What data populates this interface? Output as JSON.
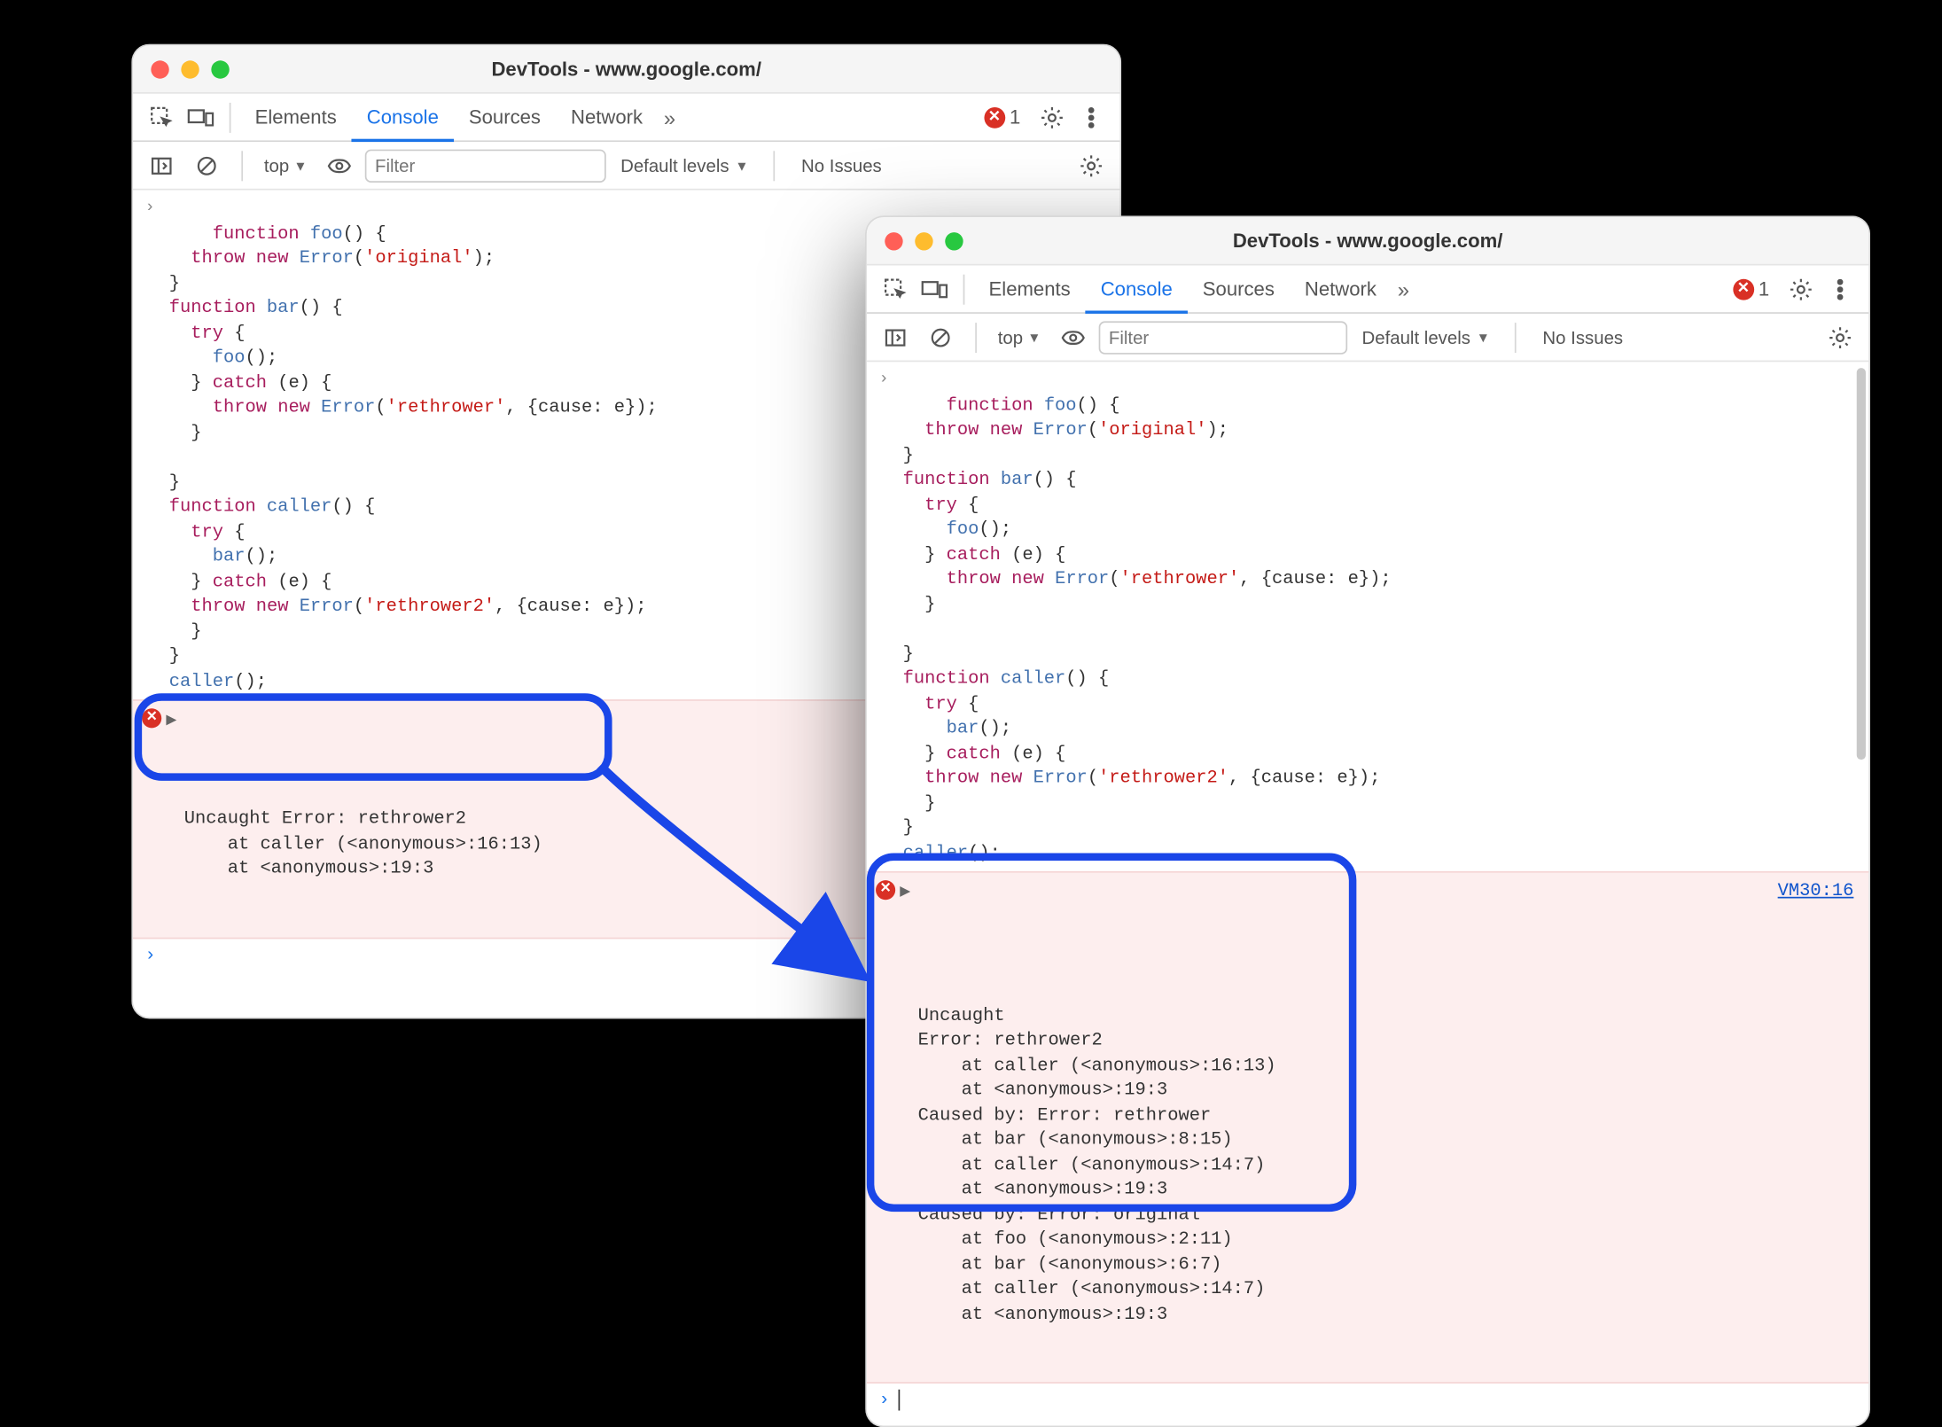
{
  "windows": {
    "win1": {
      "title": "DevTools - www.google.com/",
      "tabs": {
        "elements": "Elements",
        "console": "Console",
        "sources": "Sources",
        "network": "Network"
      },
      "error_count": "1",
      "subbar": {
        "context": "top",
        "filter_placeholder": "Filter",
        "levels": "Default levels",
        "issues": "No Issues"
      },
      "error": {
        "line1": "Uncaught Error: rethrower2",
        "line2": "    at caller (<anonymous>:16:13)",
        "line3": "    at <anonymous>:19:3"
      }
    },
    "win2": {
      "title": "DevTools - www.google.com/",
      "tabs": {
        "elements": "Elements",
        "console": "Console",
        "sources": "Sources",
        "network": "Network"
      },
      "error_count": "1",
      "subbar": {
        "context": "top",
        "filter_placeholder": "Filter",
        "levels": "Default levels",
        "issues": "No Issues"
      },
      "source_link": "VM30:16",
      "error": {
        "l0": "Uncaught",
        "l1": "Error: rethrower2",
        "l2": "    at caller (<anonymous>:16:13)",
        "l3": "    at <anonymous>:19:3",
        "l4": "Caused by: Error: rethrower",
        "l5": "    at bar (<anonymous>:8:15)",
        "l6": "    at caller (<anonymous>:14:7)",
        "l7": "    at <anonymous>:19:3",
        "l8": "Caused by: Error: original",
        "l9": "    at foo (<anonymous>:2:11)",
        "l10": "    at bar (<anonymous>:6:7)",
        "l11": "    at caller (<anonymous>:14:7)",
        "l12": "    at <anonymous>:19:3"
      }
    }
  },
  "code": {
    "foo_decl": "function foo() {",
    "throw_orig": "  throw new Error('original');",
    "close": "}",
    "bar_decl": "function bar() {",
    "try": "  try {",
    "call_foo": "    foo();",
    "catch": "  } catch (e) {",
    "throw_re": "    throw new Error('rethrower', {cause: e});",
    "close_inner": "  }",
    "blank": "",
    "caller_decl": "function caller() {",
    "call_bar": "    bar();",
    "throw_re2": "  throw new Error('rethrower2', {cause: e});",
    "call_caller": "caller();"
  }
}
